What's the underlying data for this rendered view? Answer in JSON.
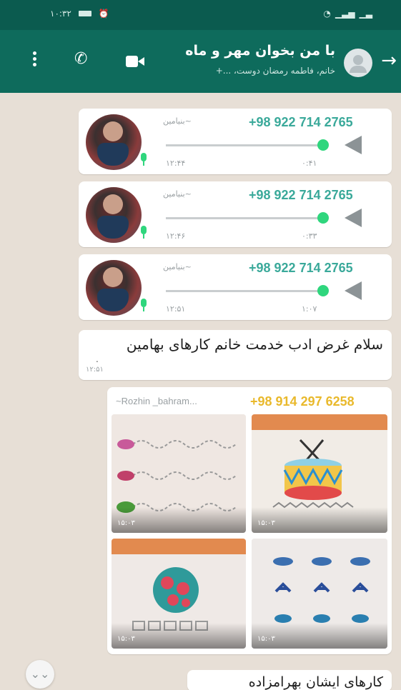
{
  "status_bar": {
    "time": "۱۰:۳۲",
    "right_icons": [
      "wifi-icon",
      "signal-icon",
      "signal-icon"
    ]
  },
  "header": {
    "title": "با من بخوان مهر و ماه",
    "subtitle": "خانم، فاطمه رمضان دوست، ...+",
    "icons": [
      "back-arrow-icon",
      "group-avatar-icon",
      "video-call-icon",
      "voice-call-icon",
      "more-vert-icon"
    ]
  },
  "messages": {
    "audio": [
      {
        "sender": "+98 922 714 2765",
        "alias": "~بنیامین",
        "duration": "۰:۴۱",
        "time": "۱۲:۴۴"
      },
      {
        "sender": "+98 922 714 2765",
        "alias": "~بنیامین",
        "duration": "۰:۳۳",
        "time": "۱۲:۴۶"
      },
      {
        "sender": "+98 922 714 2765",
        "alias": "~بنیامین",
        "duration": "۱:۰۷",
        "time": "۱۲:۵۱"
      }
    ],
    "text": {
      "body": "سلام غرض ادب خدمت خانم کارهای بهامین",
      "time": "۱۲:۵۱",
      "extra": "."
    },
    "images": {
      "sender": "+98 914 297 6258",
      "alias": "~Rozhin _bahram...",
      "timestamps": [
        "۱۵:۰۳",
        "۱۵:۰۳",
        "۱۵:۰۳",
        "۱۵:۰۳"
      ]
    },
    "partial": {
      "body": "کارهای ایشان بهرامزاده"
    }
  },
  "colors": {
    "header": "#0e6b5c",
    "status_bar": "#0b5b4f",
    "sender_teal": "#3aa99a",
    "sender_yellow": "#e9b92c",
    "audio_knob": "#2fd67d"
  }
}
